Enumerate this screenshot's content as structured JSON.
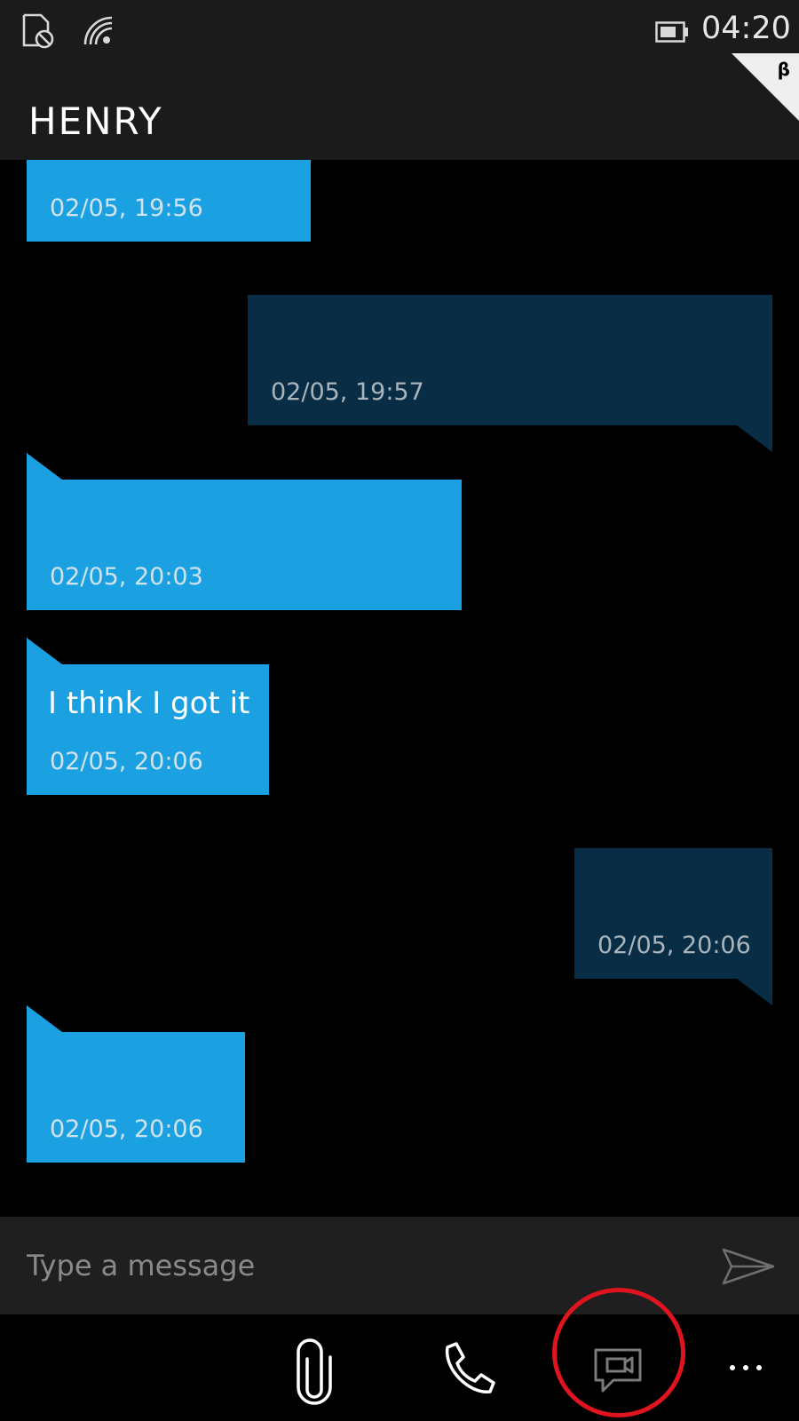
{
  "status_bar": {
    "time": "04:20",
    "icons": [
      "no-sim-icon",
      "wifi-icon",
      "battery-icon"
    ]
  },
  "header": {
    "title": "HENRY",
    "badge": "β"
  },
  "messages": [
    {
      "direction": "incoming",
      "text": "",
      "timestamp": "02/05, 19:56"
    },
    {
      "direction": "outgoing",
      "text": "",
      "timestamp": "02/05, 19:57"
    },
    {
      "direction": "incoming",
      "text": "",
      "timestamp": "02/05, 20:03"
    },
    {
      "direction": "incoming",
      "text": "I think I got it",
      "timestamp": "02/05, 20:06"
    },
    {
      "direction": "outgoing",
      "text": "",
      "timestamp": "02/05, 20:06"
    },
    {
      "direction": "incoming",
      "text": "",
      "timestamp": "02/05, 20:06"
    }
  ],
  "composer": {
    "placeholder": "Type a message",
    "send_icon": "send-icon"
  },
  "app_bar": {
    "buttons": [
      "attach-icon",
      "phone-icon",
      "video-message-icon",
      "more-icon"
    ],
    "more_label": "..."
  },
  "colors": {
    "incoming_bubble": "#1ba1e2",
    "outgoing_bubble": "#082d45",
    "chrome_background": "#1b1b1b",
    "highlight_ring": "#e0141e"
  }
}
